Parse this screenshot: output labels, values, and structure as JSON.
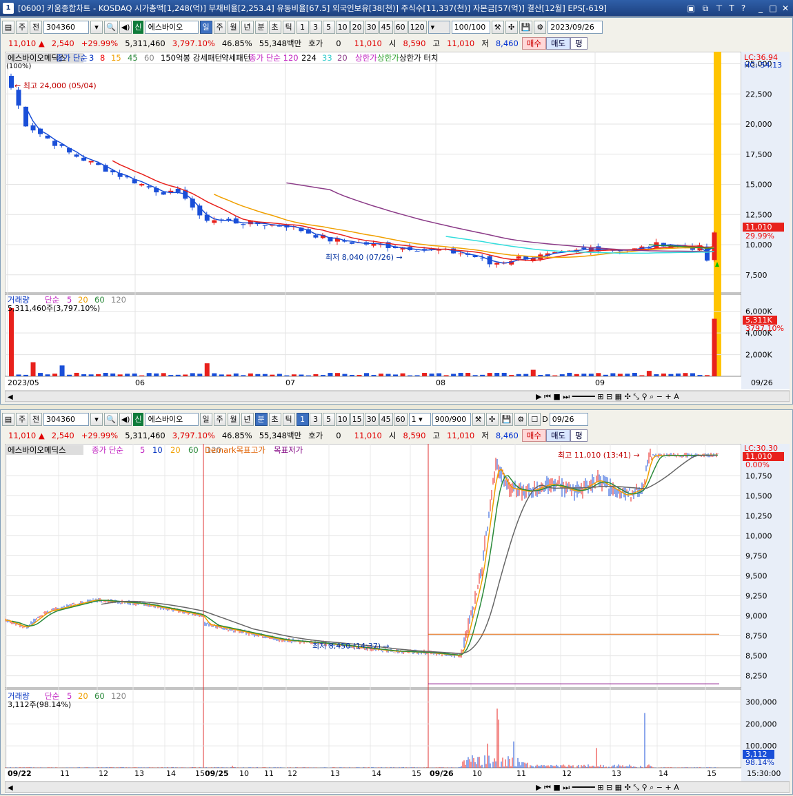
{
  "window": {
    "number": "1",
    "title": "[0600] 키움종합차트 - KOSDAQ 시가총액[1,248(억)] 부채비율[2,253.4] 유동비율[67.5] 외국인보유[38(천)] 주식수[11,337(천)] 자본금[57(억)] 결산[12월] EPS[-619]"
  },
  "top": {
    "toolbar": {
      "type": "주",
      "code_label": "전",
      "code": "304360",
      "badge": "신",
      "name": "에스바이오",
      "periods": [
        "일",
        "주",
        "월",
        "년"
      ],
      "intraday": [
        "분",
        "초",
        "틱"
      ],
      "nums": [
        "1",
        "3",
        "5",
        "10",
        "20",
        "30",
        "45",
        "60",
        "120"
      ],
      "count": "100/100",
      "date": "2023/09/26"
    },
    "quote": {
      "price": "11,010",
      "change": "2,540",
      "pct": "+29.99%",
      "volume": "5,311,460",
      "vol_ratio": "3,797.10%",
      "turnover": "46.85%",
      "amount": "55,348백만",
      "hoga_label": "호가",
      "hoga": "0",
      "hoga_price": "11,010",
      "open_label": "시",
      "open": "8,590",
      "high_label": "고",
      "high": "11,010",
      "low_label": "저",
      "low": "8,460",
      "buy": "매수",
      "sell": "매도",
      "avg": "평"
    },
    "legend": {
      "name": "에스바이오메딕스",
      "ma": "종가 단순",
      "ma_periods": [
        "3",
        "8",
        "15",
        "45",
        "60"
      ],
      "p1": "150억봉 강세패턴",
      "p2": "약세패턴",
      "ma2": "종가 단순 120",
      "ma2_periods": [
        "224",
        "33",
        "20"
      ],
      "up1": "상한가",
      "up2": "상한가",
      "up3": "상한가 터치",
      "pct_label": "(100%)"
    },
    "lc": "LC:36.94",
    "hc": "HC:-54.13",
    "annot_high": "최고 24,000 (05/04)",
    "annot_low": "최저 8,040 (07/26)",
    "y_ticks": [
      "25,000",
      "22,500",
      "20,000",
      "17,500",
      "15,000",
      "12,500",
      "10,000",
      "7,500"
    ],
    "price_tag": "11,010",
    "pct_tag": "29.99%",
    "vol_legend": {
      "name": "거래량",
      "ma": "단순",
      "periods": [
        "5",
        "20",
        "60",
        "120"
      ],
      "value": "5,311,460주(3,797.10%)"
    },
    "vol_ticks": [
      "6,000K",
      "4,000K",
      "2,000K"
    ],
    "vol_tag": "5,311K",
    "vol_pct_tag": "3797.10%",
    "x_ticks": [
      "2023/05",
      "06",
      "07",
      "08",
      "09"
    ],
    "x_last": "09/26"
  },
  "bottom": {
    "toolbar": {
      "type": "주",
      "code_label": "전",
      "code": "304360",
      "badge": "신",
      "name": "에스바이오",
      "periods": [
        "일",
        "주",
        "월",
        "년"
      ],
      "intraday": [
        "분",
        "초",
        "틱"
      ],
      "nums": [
        "1",
        "3",
        "5",
        "10",
        "15",
        "30",
        "45",
        "60"
      ],
      "unit": "1",
      "count": "900/900",
      "date_label": "D",
      "date": "09/26"
    },
    "quote": {
      "price": "11,010",
      "change": "2,540",
      "pct": "+29.99%",
      "volume": "5,311,460",
      "vol_ratio": "3,797.10%",
      "turnover": "46.85%",
      "amount": "55,348백만",
      "hoga_label": "호가",
      "hoga": "0",
      "hoga_price": "11,010",
      "open_label": "시",
      "open": "8,590",
      "high_label": "고",
      "high": "11,010",
      "low_label": "저",
      "low": "8,460",
      "buy": "매수",
      "sell": "매도",
      "avg": "평"
    },
    "legend": {
      "name": "에스바이오메딕스",
      "ma": "종가 단순",
      "ma_periods": [
        "5",
        "10",
        "20",
        "60",
        "120"
      ],
      "demark": "Demark목표고가",
      "demark2": "목표저가"
    },
    "lc": "LC:30.30",
    "annot_high": "최고 11,010 (13:41)",
    "annot_low": "최저 8,450 (14:37)",
    "y_ticks": [
      "10,750",
      "10,500",
      "10,250",
      "10,000",
      "9,750",
      "9,500",
      "9,250",
      "9,000",
      "8,750",
      "8,500",
      "8,250"
    ],
    "price_tag": "11,010",
    "pct_tag": "0.00%",
    "vol_legend": {
      "name": "거래량",
      "ma": "단순",
      "periods": [
        "5",
        "20",
        "60",
        "120"
      ],
      "value": "3,112주(98.14%)"
    },
    "vol_ticks": [
      "300,000",
      "200,000",
      "100,000"
    ],
    "vol_tag": "3,112",
    "vol_pct_tag": "98.14%",
    "x_ticks": [
      "09/22",
      "11",
      "12",
      "13",
      "14",
      "15",
      "09/25",
      "10",
      "11",
      "12",
      "13",
      "14",
      "15",
      "09/26",
      "10",
      "11",
      "12",
      "13",
      "14",
      "15"
    ],
    "x_last": "15:30:00"
  },
  "colors": {
    "up": "#e8211c",
    "down": "#1a4fd8",
    "bg": "#ffffff",
    "grid": "#dddddd",
    "hl": "#ffc400"
  }
}
